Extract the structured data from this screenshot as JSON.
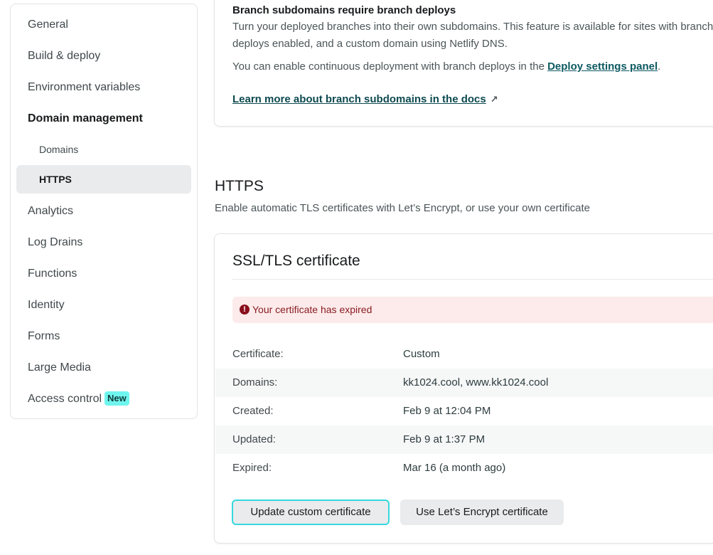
{
  "sidebar": {
    "items": [
      {
        "label": "General"
      },
      {
        "label": "Build & deploy"
      },
      {
        "label": "Environment variables"
      },
      {
        "label": "Domain management"
      },
      {
        "label": "Domains"
      },
      {
        "label": "HTTPS"
      },
      {
        "label": "Analytics"
      },
      {
        "label": "Log Drains"
      },
      {
        "label": "Functions"
      },
      {
        "label": "Identity"
      },
      {
        "label": "Forms"
      },
      {
        "label": "Large Media"
      },
      {
        "label": "Access control",
        "badge": "New"
      }
    ]
  },
  "branch_card": {
    "heading": "Branch subdomains require branch deploys",
    "para1": "Turn your deployed branches into their own subdomains. This feature is available for sites with branch deploys enabled, and a custom domain using Netlify DNS.",
    "para2_prefix": "You can enable continuous deployment with branch deploys in the ",
    "para2_link": "Deploy settings panel",
    "para2_suffix": ".",
    "docs_link": "Learn more about branch subdomains in the docs",
    "docs_arrow": "↗"
  },
  "https_section": {
    "title": "HTTPS",
    "description": "Enable automatic TLS certificates with Let’s Encrypt, or use your own certificate"
  },
  "ssl_card": {
    "title": "SSL/TLS certificate",
    "alert": "Your certificate has expired",
    "alert_icon": "!",
    "rows": [
      {
        "label": "Certificate:",
        "value": "Custom"
      },
      {
        "label": "Domains:",
        "value": "kk1024.cool, www.kk1024.cool"
      },
      {
        "label": "Created:",
        "value": "Feb 9 at 12:04 PM"
      },
      {
        "label": "Updated:",
        "value": "Feb 9 at 1:37 PM"
      },
      {
        "label": "Expired:",
        "value": "Mar 16 (a month ago)"
      }
    ],
    "btn_update": "Update custom certificate",
    "btn_letsencrypt": "Use Let’s Encrypt certificate"
  },
  "colors": {
    "accent": "#35d8df",
    "badge_new": "#6ef5ee",
    "alert_bg": "#fcebea",
    "alert_text": "#8a1c24",
    "link": "#0d5961"
  }
}
